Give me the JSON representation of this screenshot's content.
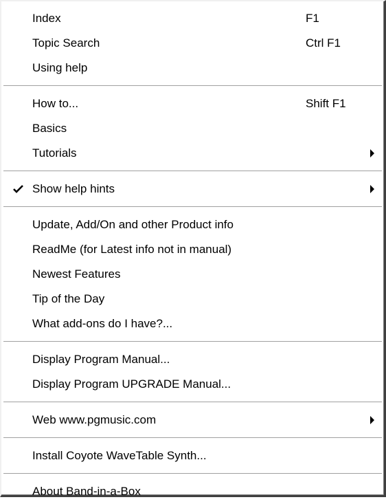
{
  "menu": {
    "index": {
      "label": "Index",
      "shortcut": "F1"
    },
    "topic_search": {
      "label": "Topic Search",
      "shortcut": "Ctrl F1"
    },
    "using_help": {
      "label": "Using help"
    },
    "how_to": {
      "label": "How to...",
      "shortcut": "Shift F1"
    },
    "basics": {
      "label": "Basics"
    },
    "tutorials": {
      "label": "Tutorials"
    },
    "show_help_hints": {
      "label": "Show help hints",
      "checked": true
    },
    "update_info": {
      "label": "Update, Add/On and other Product info"
    },
    "readme": {
      "label": "ReadMe (for Latest info not in manual)"
    },
    "newest_features": {
      "label": "Newest Features"
    },
    "tip_of_day": {
      "label": "Tip of the Day"
    },
    "addons": {
      "label": "What add-ons do I have?..."
    },
    "program_manual": {
      "label": "Display Program Manual..."
    },
    "upgrade_manual": {
      "label": "Display Program UPGRADE Manual..."
    },
    "web": {
      "label": "Web www.pgmusic.com"
    },
    "coyote": {
      "label": "Install Coyote WaveTable Synth..."
    },
    "about": {
      "label": "About Band-in-a-Box"
    }
  },
  "colors": {
    "background": "#ffffff",
    "text": "#000000",
    "separator": "#a0a0a0"
  }
}
